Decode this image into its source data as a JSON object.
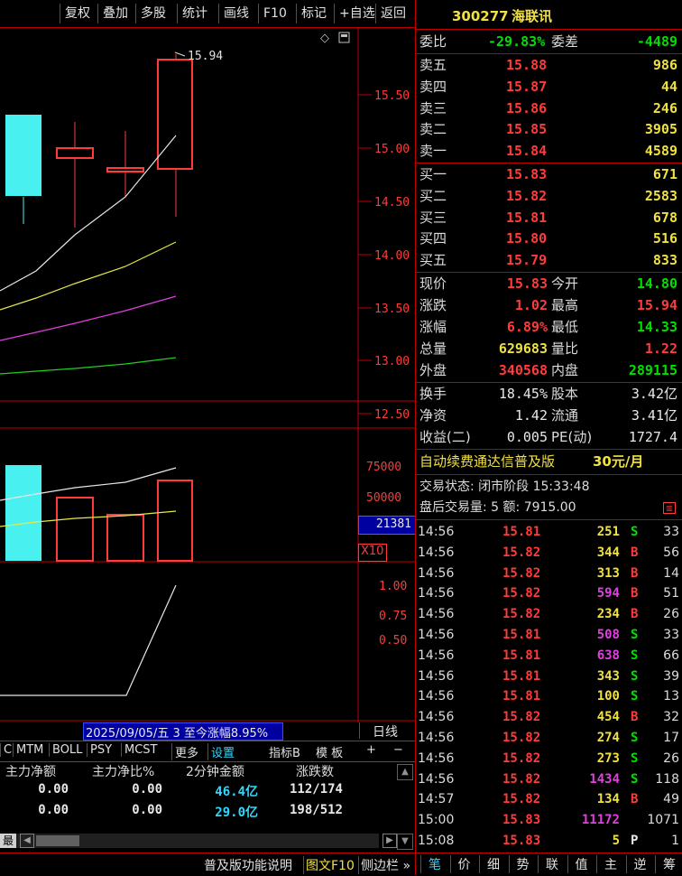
{
  "toolbar": [
    "复权",
    "叠加",
    "多股",
    "统计",
    "画线",
    "F10",
    "标记",
    "+自选",
    "返回"
  ],
  "chart": {
    "price_axis": [
      "15.50",
      "15.00",
      "14.50",
      "14.00",
      "13.50",
      "13.00",
      "12.50"
    ],
    "high_marker": "15.94",
    "volume_axis": [
      "75000",
      "50000"
    ],
    "volume_current": "21381",
    "volume_unit": "X10",
    "indicator_axis": [
      "1.00",
      "0.75",
      "0.50"
    ],
    "date_label": "2025/09/05/五 3 至今涨幅8.95%",
    "period": "日线",
    "indicator_tabs": [
      "C",
      "MTM",
      "BOLL",
      "PSY",
      "MCST",
      "更多",
      "设置"
    ],
    "indicator_buttons": [
      "指标B",
      "模 板",
      "+",
      "−"
    ]
  },
  "fund_table": {
    "headers": [
      "主力净额",
      "主力净比%",
      "2分钟金额",
      "涨跌数"
    ],
    "rows": [
      [
        "0.00",
        "0.00",
        "46.4亿",
        "112/174"
      ],
      [
        "0.00",
        "0.00",
        "29.0亿",
        "198/512"
      ]
    ],
    "left_tab": "最"
  },
  "stock": {
    "code": "300277",
    "name": "海联讯"
  },
  "weibi": {
    "label1": "委比",
    "ratio": "-29.83%",
    "label2": "委差",
    "diff": "-4489"
  },
  "asks": [
    {
      "label": "卖五",
      "price": "15.88",
      "vol": "986"
    },
    {
      "label": "卖四",
      "price": "15.87",
      "vol": "44"
    },
    {
      "label": "卖三",
      "price": "15.86",
      "vol": "246"
    },
    {
      "label": "卖二",
      "price": "15.85",
      "vol": "3905"
    },
    {
      "label": "卖一",
      "price": "15.84",
      "vol": "4589"
    }
  ],
  "bids": [
    {
      "label": "买一",
      "price": "15.83",
      "vol": "671"
    },
    {
      "label": "买二",
      "price": "15.82",
      "vol": "2583"
    },
    {
      "label": "买三",
      "price": "15.81",
      "vol": "678"
    },
    {
      "label": "买四",
      "price": "15.80",
      "vol": "516"
    },
    {
      "label": "买五",
      "price": "15.79",
      "vol": "833"
    }
  ],
  "quote": [
    {
      "l1": "现价",
      "v1": "15.83",
      "l2": "今开",
      "v2": "14.80",
      "c1": "red",
      "c2": "green"
    },
    {
      "l1": "涨跌",
      "v1": "1.02",
      "l2": "最高",
      "v2": "15.94",
      "c1": "red",
      "c2": "red"
    },
    {
      "l1": "涨幅",
      "v1": "6.89%",
      "l2": "最低",
      "v2": "14.33",
      "c1": "red",
      "c2": "green"
    },
    {
      "l1": "总量",
      "v1": "629683",
      "l2": "量比",
      "v2": "1.22",
      "c1": "yellow",
      "c2": "red"
    },
    {
      "l1": "外盘",
      "v1": "340568",
      "l2": "内盘",
      "v2": "289115",
      "c1": "red",
      "c2": "green"
    }
  ],
  "fundamentals": [
    {
      "l1": "换手",
      "v1": "18.45%",
      "l2": "股本",
      "v2": "3.42亿"
    },
    {
      "l1": "净资",
      "v1": "1.42",
      "l2": "流通",
      "v2": "3.41亿"
    },
    {
      "l1": "收益(二)",
      "v1": "0.005",
      "l2": "PE(动)",
      "v2": "1727.4"
    }
  ],
  "promo": {
    "text": "自动续费通达信普及版",
    "price": "30元/月"
  },
  "status": {
    "state": "交易状态: 闭市阶段 15:33:48",
    "after": "盘后交易量: 5  额: 7915.00"
  },
  "ticks": [
    {
      "t": "14:56",
      "p": "15.81",
      "v": "251",
      "d": "S",
      "n": "33",
      "vc": "yellow"
    },
    {
      "t": "14:56",
      "p": "15.82",
      "v": "344",
      "d": "B",
      "n": "56",
      "vc": "yellow"
    },
    {
      "t": "14:56",
      "p": "15.82",
      "v": "313",
      "d": "B",
      "n": "14",
      "vc": "yellow"
    },
    {
      "t": "14:56",
      "p": "15.82",
      "v": "594",
      "d": "B",
      "n": "51",
      "vc": "magenta"
    },
    {
      "t": "14:56",
      "p": "15.82",
      "v": "234",
      "d": "B",
      "n": "26",
      "vc": "yellow"
    },
    {
      "t": "14:56",
      "p": "15.81",
      "v": "508",
      "d": "S",
      "n": "33",
      "vc": "magenta"
    },
    {
      "t": "14:56",
      "p": "15.81",
      "v": "638",
      "d": "S",
      "n": "66",
      "vc": "magenta"
    },
    {
      "t": "14:56",
      "p": "15.81",
      "v": "343",
      "d": "S",
      "n": "39",
      "vc": "yellow"
    },
    {
      "t": "14:56",
      "p": "15.81",
      "v": "100",
      "d": "S",
      "n": "13",
      "vc": "yellow"
    },
    {
      "t": "14:56",
      "p": "15.82",
      "v": "454",
      "d": "B",
      "n": "32",
      "vc": "yellow"
    },
    {
      "t": "14:56",
      "p": "15.82",
      "v": "274",
      "d": "S",
      "n": "17",
      "vc": "yellow"
    },
    {
      "t": "14:56",
      "p": "15.82",
      "v": "273",
      "d": "S",
      "n": "26",
      "vc": "yellow"
    },
    {
      "t": "14:56",
      "p": "15.82",
      "v": "1434",
      "d": "S",
      "n": "118",
      "vc": "magenta"
    },
    {
      "t": "14:57",
      "p": "15.82",
      "v": "134",
      "d": "B",
      "n": "49",
      "vc": "yellow"
    },
    {
      "t": "15:00",
      "p": "15.83",
      "v": "11172",
      "d": "",
      "n": "1071",
      "vc": "magenta"
    },
    {
      "t": "15:08",
      "p": "15.83",
      "v": "5",
      "d": "P",
      "n": "1",
      "vc": "yellow"
    }
  ],
  "bottom_links": {
    "help": "普及版功能说明",
    "f10": "图文F10",
    "sidebar": "侧边栏 »"
  },
  "bottom_tabs": [
    "笔",
    "价",
    "细",
    "势",
    "联",
    "值",
    "主",
    "逆",
    "筹"
  ]
}
